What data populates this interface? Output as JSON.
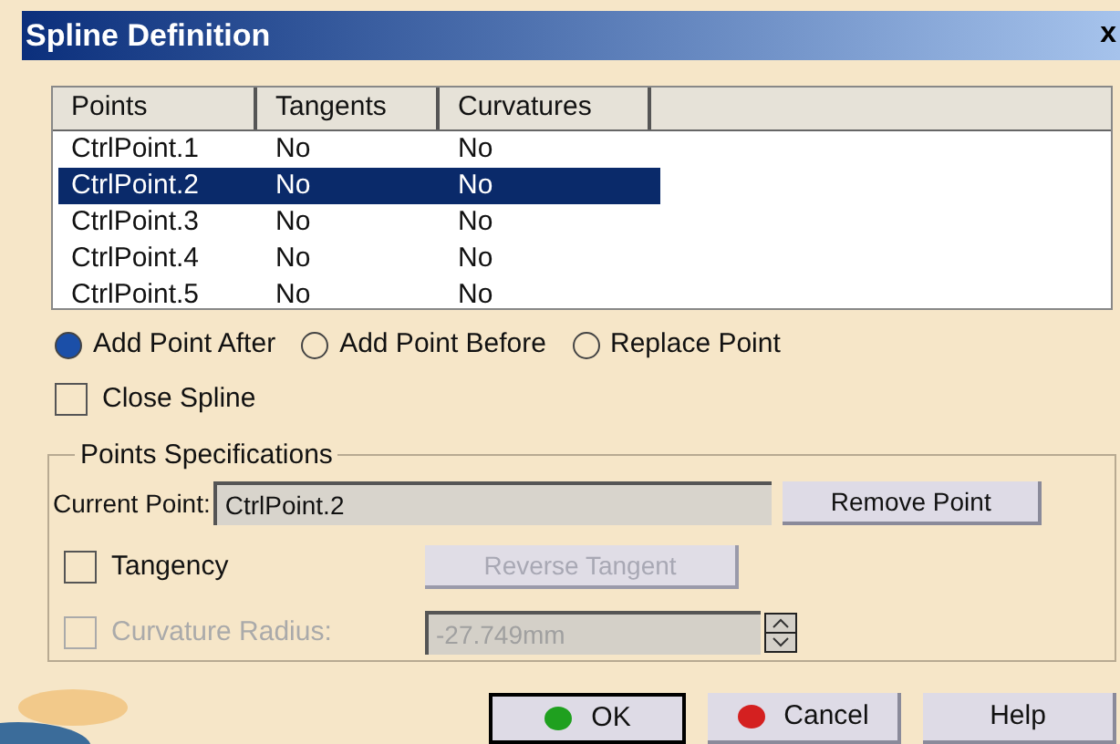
{
  "window": {
    "title": "Spline Definition",
    "close": "x"
  },
  "table": {
    "columns": [
      "Points",
      "Tangents",
      "Curvatures"
    ],
    "rows": [
      {
        "cells": [
          "CtrlPoint.1",
          "No",
          "No"
        ],
        "selected": false
      },
      {
        "cells": [
          "CtrlPoint.2",
          "No",
          "No"
        ],
        "selected": true
      },
      {
        "cells": [
          "CtrlPoint.3",
          "No",
          "No"
        ],
        "selected": false
      },
      {
        "cells": [
          "CtrlPoint.4",
          "No",
          "No"
        ],
        "selected": false
      },
      {
        "cells": [
          "CtrlPoint.5",
          "No",
          "No"
        ],
        "selected": false
      }
    ]
  },
  "insert_mode": [
    {
      "label": "Add Point After",
      "selected": true
    },
    {
      "label": "Add Point Before",
      "selected": false
    },
    {
      "label": "Replace Point",
      "selected": false
    }
  ],
  "close_spline": {
    "label": "Close Spline",
    "checked": false
  },
  "points_specifications": {
    "title": "Points Specifications",
    "current_point": {
      "label": "Current Point:",
      "value": "CtrlPoint.2"
    },
    "remove_button": "Remove Point",
    "tangency": {
      "label": "Tangency",
      "checked": false,
      "disabled": false
    },
    "reverse_tangent": {
      "label": "Reverse Tangent",
      "disabled": true
    },
    "curvature_radius": {
      "label": "Curvature Radius:",
      "checked": false,
      "disabled": true,
      "value": "-27.749mm"
    }
  },
  "buttons": [
    {
      "label": "OK",
      "kind": "ok"
    },
    {
      "label": "Cancel",
      "kind": "cancel"
    },
    {
      "label": "Help",
      "kind": "help"
    }
  ]
}
